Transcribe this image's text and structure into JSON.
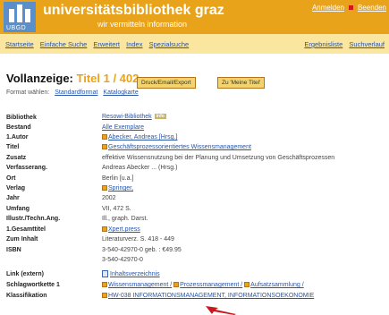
{
  "header": {
    "logo_text": "UBGD",
    "title": "universitätsbibliothek graz",
    "subtitle": "wir vermitteln information",
    "links": [
      "Anmelden",
      "Beenden"
    ]
  },
  "nav": {
    "left": [
      "Startseite",
      "Einfache Suche",
      "Erweitert",
      "Index",
      "Spezialsuche"
    ],
    "right": [
      "Ergebnisliste",
      "Suchverlauf"
    ]
  },
  "full_view": {
    "heading_prefix": "Vollanzeige:",
    "heading_title": "Titel 1 / 402",
    "btn_export": "Druck/Email/Export",
    "btn_meine": "Zu 'Meine Titel'",
    "format_label": "Format wählen:",
    "format_options": [
      "Standardformat",
      "Katalogkarte"
    ]
  },
  "record": {
    "bibliothek": {
      "label": "Bibliothek",
      "value": "Resowi-Bibliothek",
      "badge": "info"
    },
    "bestand": {
      "label": "Bestand",
      "value": "Alle Exemplare"
    },
    "autor": {
      "label": "1.Autor",
      "value": "Abecker, Andreas [Hrsg.]"
    },
    "titel": {
      "label": "Titel",
      "value": "Geschäftsprozessorientiertes Wissensmanagement"
    },
    "zusatz": {
      "label": "Zusatz",
      "value": "effektive Wissensnutzung bei der Planung und Umsetzung von Geschäftsprozessen"
    },
    "verfasser": {
      "label": "Verfasserang.",
      "value": "Andreas Abecker ... (Hrsg.)"
    },
    "ort": {
      "label": "Ort",
      "value": "Berlin [u.a.]"
    },
    "verlag": {
      "label": "Verlag",
      "value": "Springer,"
    },
    "jahr": {
      "label": "Jahr",
      "value": "2002"
    },
    "umfang": {
      "label": "Umfang",
      "value": "VII, 472 S."
    },
    "illustr": {
      "label": "Illustr./Techn.Ang.",
      "value": "Ill., graph. Darst."
    },
    "gesamttitel": {
      "label": "1.Gesamttitel",
      "value": "Xpert.press"
    },
    "zum_inhalt": {
      "label": "Zum Inhalt",
      "value": "Literaturverz. S. 418 - 449"
    },
    "isbn": {
      "label": "ISBN",
      "values": [
        "3-540-42970-0 geb. : €49.95",
        "3-540-42970-0"
      ]
    },
    "link_extern": {
      "label": "Link (extern)",
      "value": "Inhaltsverzeichnis"
    },
    "schlagwort": {
      "label": "Schlagwortkette 1",
      "values": [
        "Wissensmanagement /",
        "Prozessmanagement /",
        "Aufsatzsammlung /"
      ]
    },
    "klassifikation": {
      "label": "Klassifikation",
      "value": "HW-038 INFORMATIONSMANAGEMENT, INFORMATIONSOEKONOMIE"
    }
  },
  "colors": {
    "header_orange": "#e8a31a",
    "nav_yellow": "#fbe6a0",
    "link_blue": "#2855a8",
    "arrow_red": "#c8181e"
  }
}
